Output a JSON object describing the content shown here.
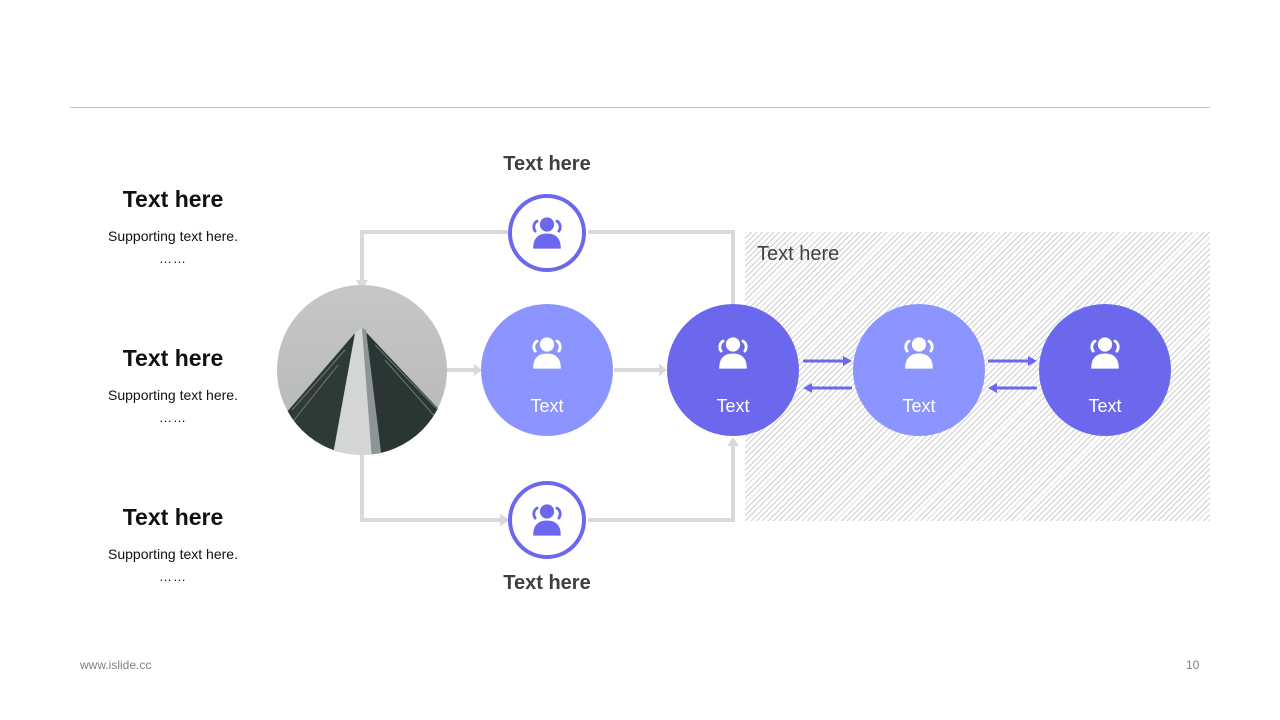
{
  "left_items": [
    {
      "title": "Text here",
      "subtitle": "Supporting text here.",
      "dots": "……"
    },
    {
      "title": "Text here",
      "subtitle": "Supporting text here.",
      "dots": "……"
    },
    {
      "title": "Text here",
      "subtitle": "Supporting text here.",
      "dots": "……"
    }
  ],
  "diagram": {
    "top_label": "Text here",
    "bottom_label": "Text here",
    "region_label": "Text here",
    "nodes": [
      {
        "label": "Text",
        "color": "#8c95ff"
      },
      {
        "label": "Text",
        "color": "#6b68ee"
      },
      {
        "label": "Text",
        "color": "#8c95ff"
      },
      {
        "label": "Text",
        "color": "#6b68ee"
      }
    ],
    "accent": "#6b68ee",
    "connector_color": "#d9d9d9"
  },
  "footer": {
    "website": "www.islide.cc",
    "page_number": "10"
  }
}
